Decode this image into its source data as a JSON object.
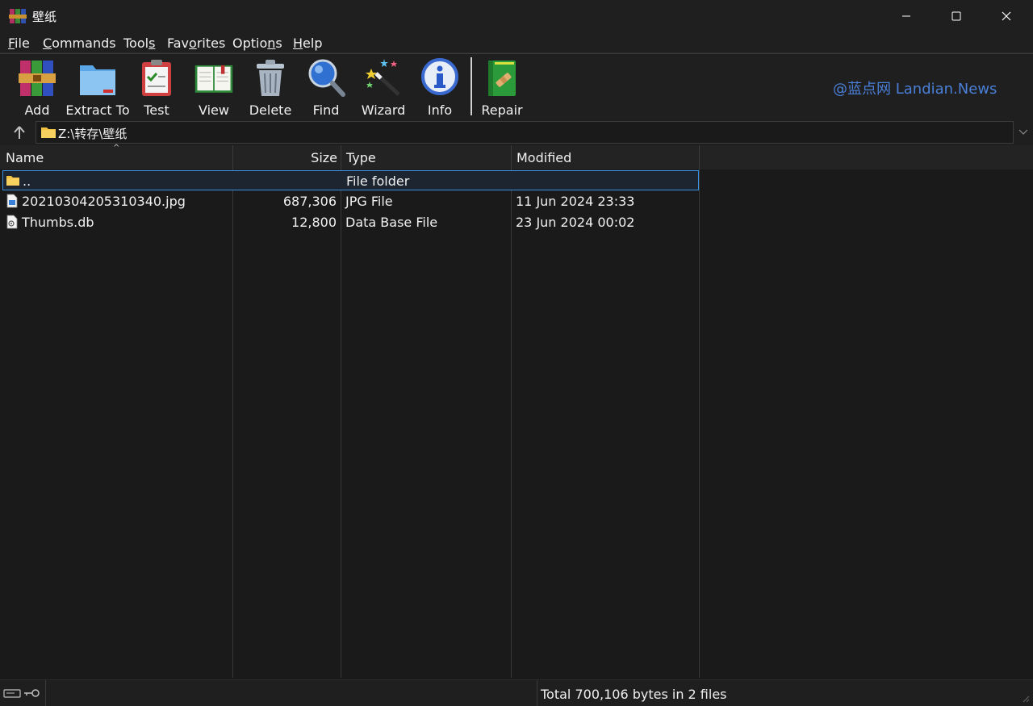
{
  "window": {
    "title": "壁纸"
  },
  "menu": [
    {
      "label_pre": "",
      "label_u": "F",
      "label_post": "ile"
    },
    {
      "label_pre": "",
      "label_u": "C",
      "label_post": "ommands"
    },
    {
      "label_pre": "Tool",
      "label_u": "s",
      "label_post": ""
    },
    {
      "label_pre": "Fav",
      "label_u": "o",
      "label_post": "rites"
    },
    {
      "label_pre": "Optio",
      "label_u": "n",
      "label_post": "s"
    },
    {
      "label_pre": "",
      "label_u": "H",
      "label_post": "elp"
    }
  ],
  "toolbar": {
    "add": "Add",
    "extract": "Extract To",
    "test": "Test",
    "view": "View",
    "delete": "Delete",
    "find": "Find",
    "wizard": "Wizard",
    "info": "Info",
    "repair": "Repair"
  },
  "watermark": "@蓝点网 Landian.News",
  "address": {
    "path": "Z:\\转存\\壁纸"
  },
  "columns": {
    "name": "Name",
    "size": "Size",
    "type": "Type",
    "modified": "Modified"
  },
  "rows": [
    {
      "icon": "folder-icon",
      "name": "..",
      "size": "",
      "type": "File folder",
      "modified": ""
    },
    {
      "icon": "image-file-icon",
      "name": "20210304205310340.jpg",
      "size": "687,306",
      "type": "JPG File",
      "modified": "11 Jun 2024 23:33"
    },
    {
      "icon": "database-file-icon",
      "name": "Thumbs.db",
      "size": "12,800",
      "type": "Data Base File",
      "modified": "23 Jun 2024 00:02"
    }
  ],
  "status": {
    "text": "Total 700,106 bytes in 2 files"
  },
  "colors": {
    "accent": "#3c8fdc",
    "watermark": "#4a7fd8"
  }
}
